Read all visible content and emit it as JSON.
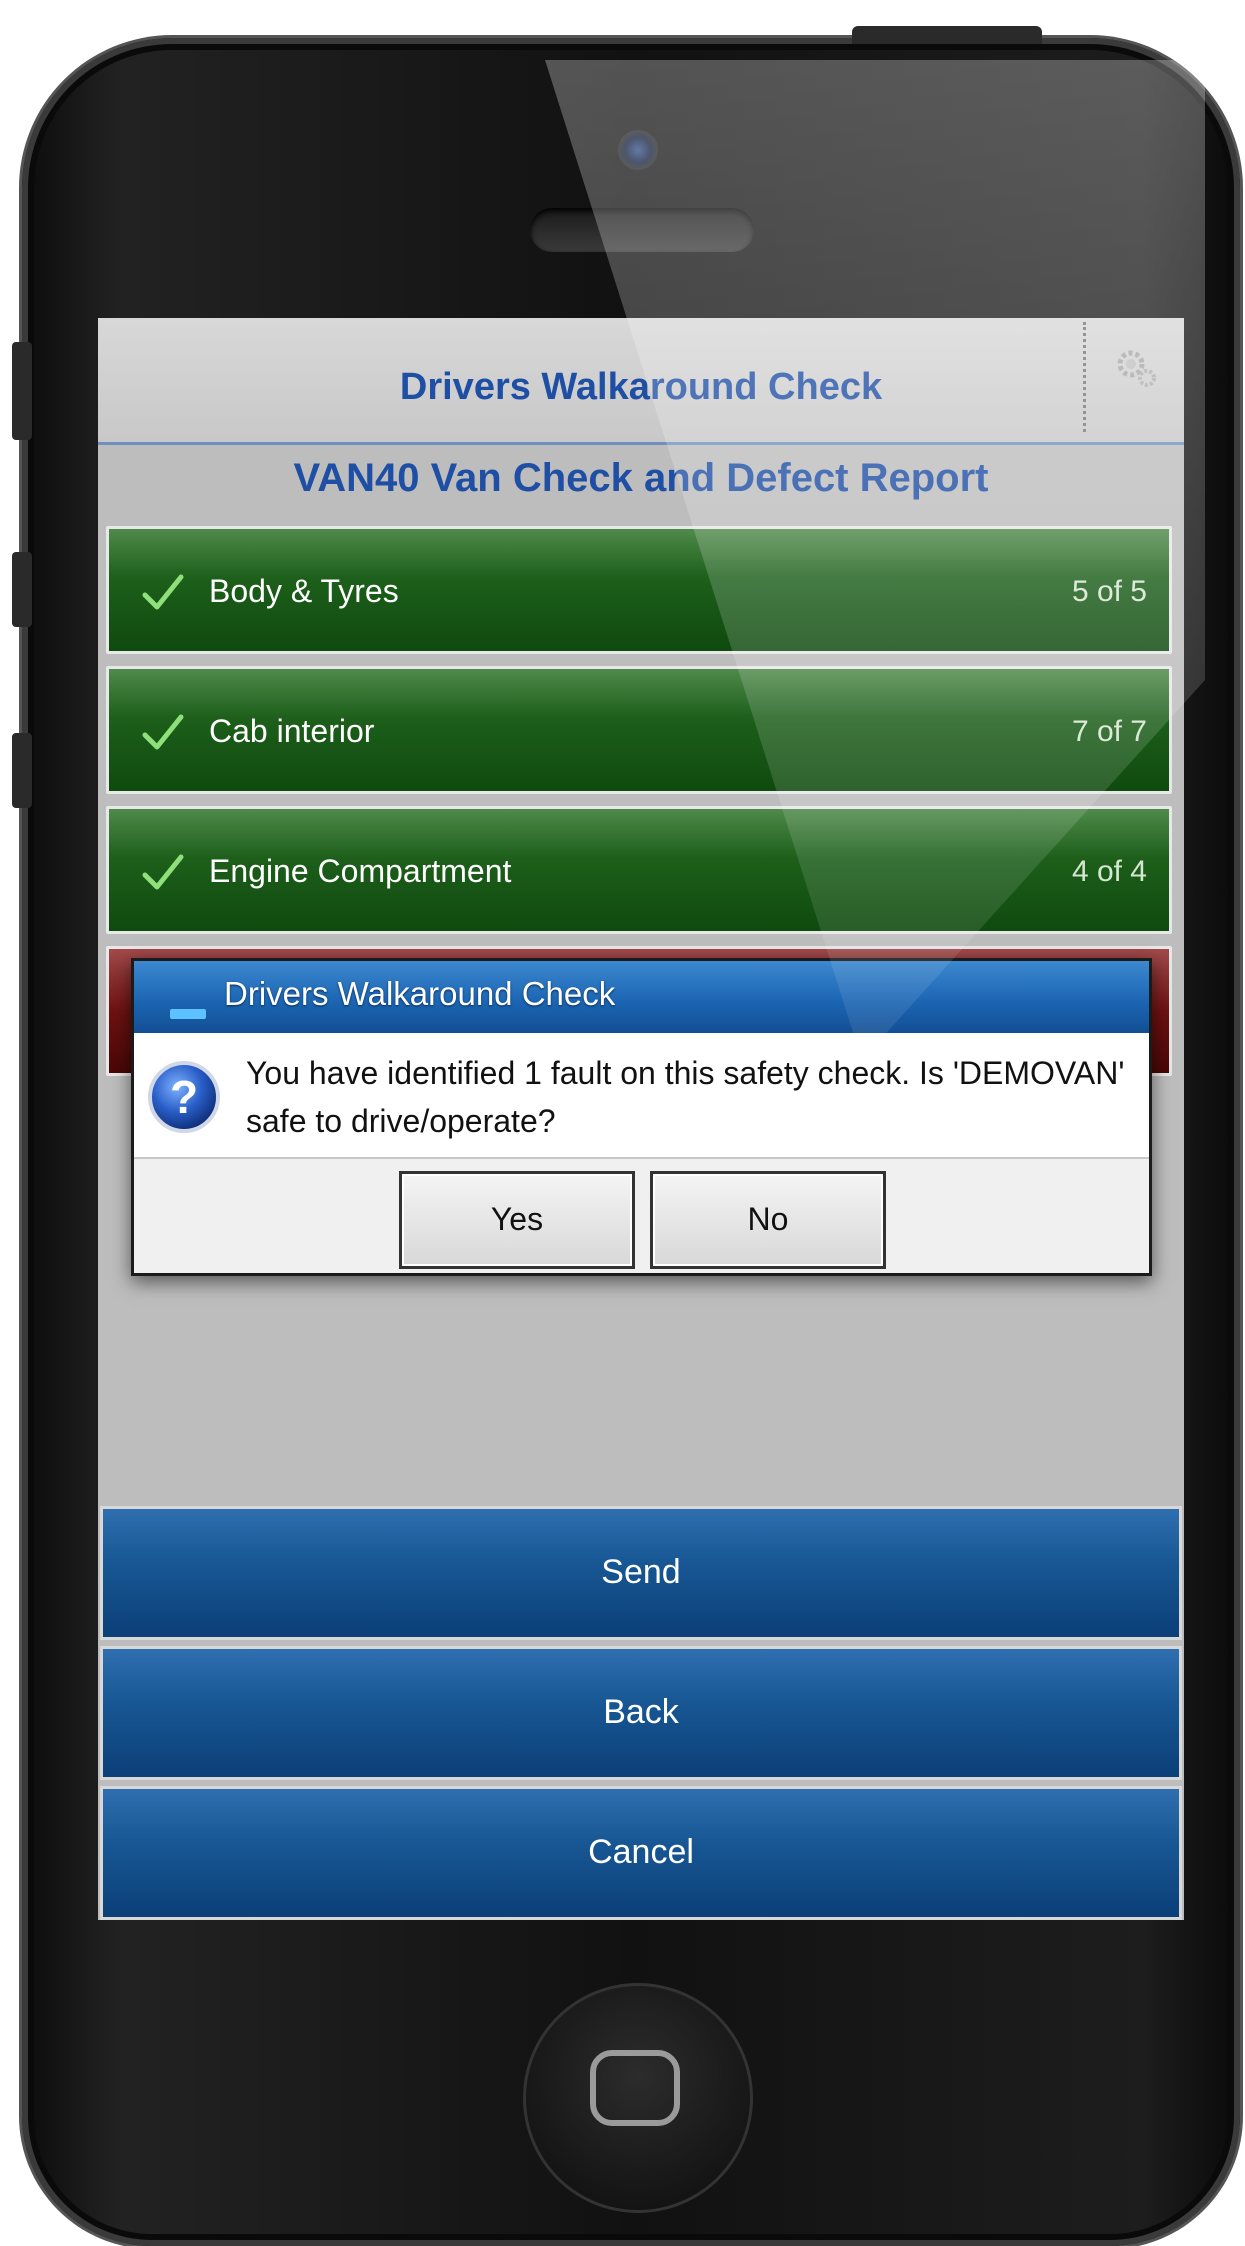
{
  "app": {
    "title": "Drivers Walkaround Check",
    "subtitle": "VAN40 Van Check and Defect Report"
  },
  "sections": [
    {
      "label": "Body & Tyres",
      "count": "5 of 5",
      "status": "complete"
    },
    {
      "label": "Cab interior",
      "count": "7 of 7",
      "status": "complete"
    },
    {
      "label": "Engine Compartment",
      "count": "4 of 4",
      "status": "complete"
    },
    {
      "label": "",
      "count": "",
      "status": "fault"
    }
  ],
  "dialog": {
    "title": "Drivers Walkaround Check",
    "message": "You have identified 1 fault on this safety check. Is 'DEMOVAN' safe to drive/operate?",
    "yes_label": "Yes",
    "no_label": "No"
  },
  "actions": {
    "send_label": "Send",
    "back_label": "Back",
    "cancel_label": "Cancel"
  },
  "icons": {
    "settings": "gear-icon",
    "check": "check-icon",
    "question": "question-icon"
  },
  "colors": {
    "title_blue": "#1f4fa5",
    "section_green": "#1d5f1b",
    "section_red": "#6e1212",
    "action_blue": "#185895",
    "dialog_title_blue": "#1c66b4"
  }
}
